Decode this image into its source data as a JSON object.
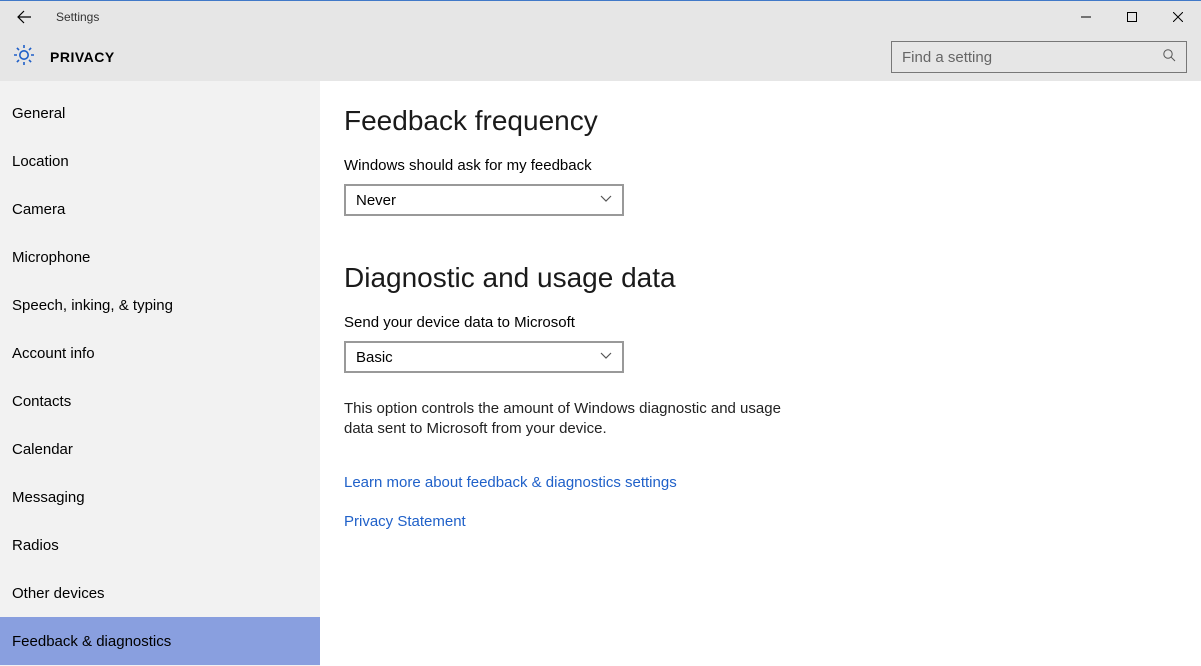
{
  "window": {
    "title": "Settings"
  },
  "header": {
    "page_title": "PRIVACY",
    "search_placeholder": "Find a setting"
  },
  "sidebar": {
    "items": [
      {
        "label": "General"
      },
      {
        "label": "Location"
      },
      {
        "label": "Camera"
      },
      {
        "label": "Microphone"
      },
      {
        "label": "Speech, inking, & typing"
      },
      {
        "label": "Account info"
      },
      {
        "label": "Contacts"
      },
      {
        "label": "Calendar"
      },
      {
        "label": "Messaging"
      },
      {
        "label": "Radios"
      },
      {
        "label": "Other devices"
      },
      {
        "label": "Feedback & diagnostics",
        "selected": true
      }
    ]
  },
  "main": {
    "feedback": {
      "heading": "Feedback frequency",
      "label": "Windows should ask for my feedback",
      "value": "Never"
    },
    "diag": {
      "heading": "Diagnostic and usage data",
      "label": "Send your device data to Microsoft",
      "value": "Basic",
      "description": "This option controls the amount of Windows diagnostic and usage data sent to Microsoft from your device."
    },
    "links": {
      "learn_more": "Learn more about feedback & diagnostics settings",
      "privacy": "Privacy Statement"
    }
  }
}
